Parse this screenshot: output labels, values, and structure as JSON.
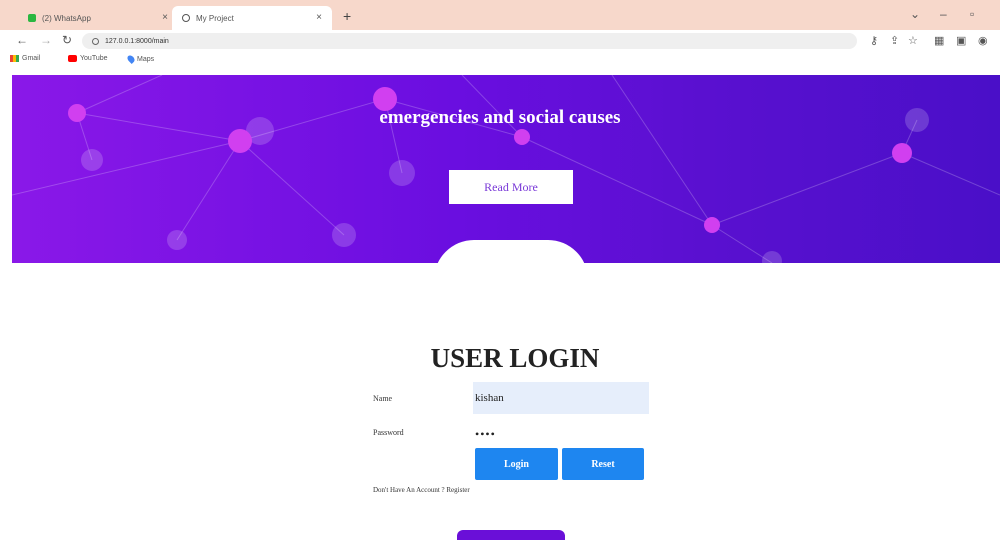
{
  "browser": {
    "tabs": [
      {
        "label": "(2) WhatsApp",
        "icon": "whatsapp-icon"
      },
      {
        "label": "My Project",
        "icon": "globe-icon"
      }
    ],
    "new_tab_glyph": "+",
    "close_glyph": "×",
    "url": "127.0.0.1:8000/main",
    "bookmarks": [
      {
        "label": "Gmail",
        "icon": "gmail-icon"
      },
      {
        "label": "YouTube",
        "icon": "youtube-icon"
      },
      {
        "label": "Maps",
        "icon": "maps-icon"
      }
    ]
  },
  "hero": {
    "text": "emergencies and social causes",
    "button_label": "Read More",
    "gradient": [
      "#8a18e8",
      "#4a0fc8"
    ]
  },
  "login": {
    "title": "USER LOGIN",
    "name_label": "Name",
    "name_value": "kishan",
    "password_label": "Password",
    "password_value": "••••",
    "login_button": "Login",
    "reset_button": "Reset",
    "register_prefix": "Don't Have An Account ?",
    "register_link": "Register"
  },
  "colors": {
    "accent": "#1e86f0",
    "hero_purple": "#6a0ee0",
    "tabbar": "#f7d8cb"
  }
}
